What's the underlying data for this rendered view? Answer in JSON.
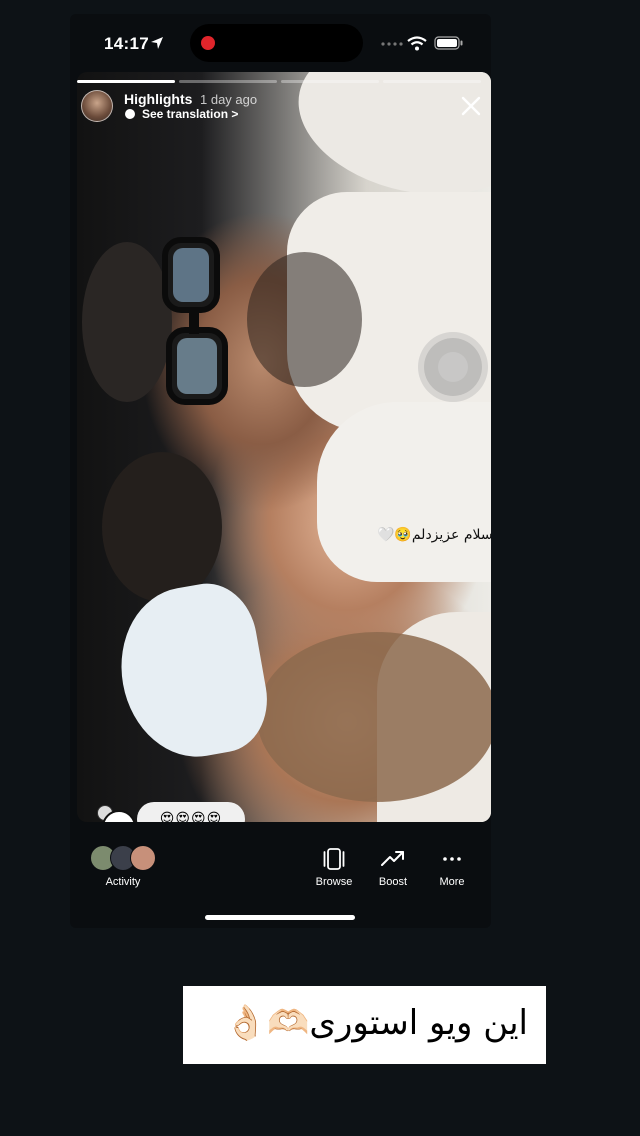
{
  "status_bar": {
    "time": "14:17",
    "location_icon": "location-arrow-icon",
    "recording_color": "#e0252b",
    "signal_icon": "cellular-signal-icon",
    "wifi_icon": "wifi-icon",
    "battery_icon": "battery-icon"
  },
  "story": {
    "progress_segments": 4,
    "progress_active": 1,
    "title": "Highlights",
    "time_ago": "1 day ago",
    "translation_label": "See translation >",
    "close_icon": "close-icon",
    "sticker_text": "سلام عزیزدلم🥹🤍",
    "reply_emojis": "😍😍😍😍"
  },
  "toolbar": {
    "activity_label": "Activity",
    "browse_label": "Browse",
    "boost_label": "Boost",
    "more_label": "More",
    "browse_icon": "browse-icon",
    "boost_icon": "trend-arrow-icon",
    "more_icon": "more-dots-icon"
  },
  "caption": {
    "text": "این ویو استوری🫶🏻👌🏻"
  },
  "colors": {
    "background": "#0d1216",
    "phone_background": "#0a0d10",
    "caption_background": "#ffffff"
  }
}
